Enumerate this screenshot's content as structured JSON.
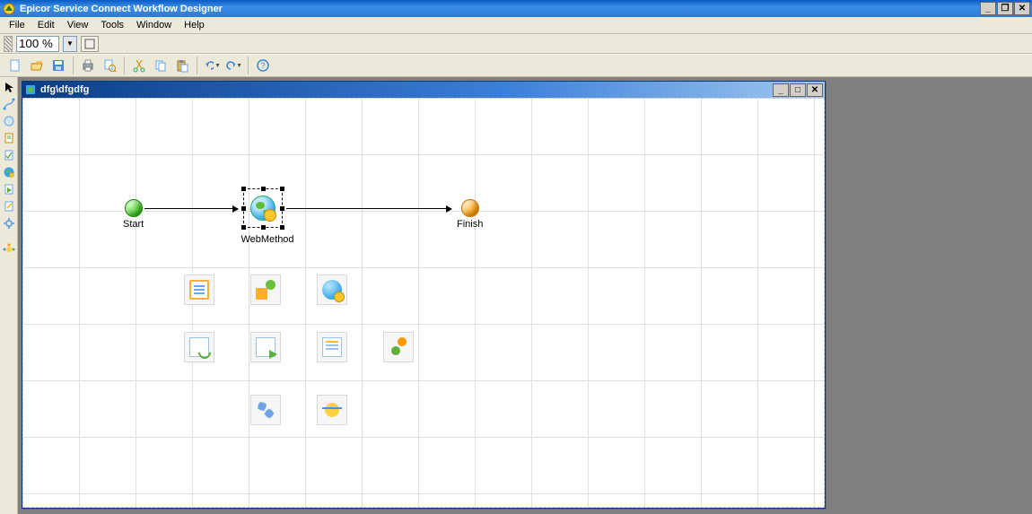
{
  "app": {
    "title": "Epicor Service Connect Workflow Designer"
  },
  "menu": {
    "items": [
      "File",
      "Edit",
      "View",
      "Tools",
      "Window",
      "Help"
    ]
  },
  "zoom": {
    "value": "100 %"
  },
  "document": {
    "title": "dfg\\dfgdfg"
  },
  "nodes": {
    "start": {
      "label": "Start"
    },
    "webmethod": {
      "label": "WebMethod"
    },
    "finish": {
      "label": "Finish"
    }
  }
}
